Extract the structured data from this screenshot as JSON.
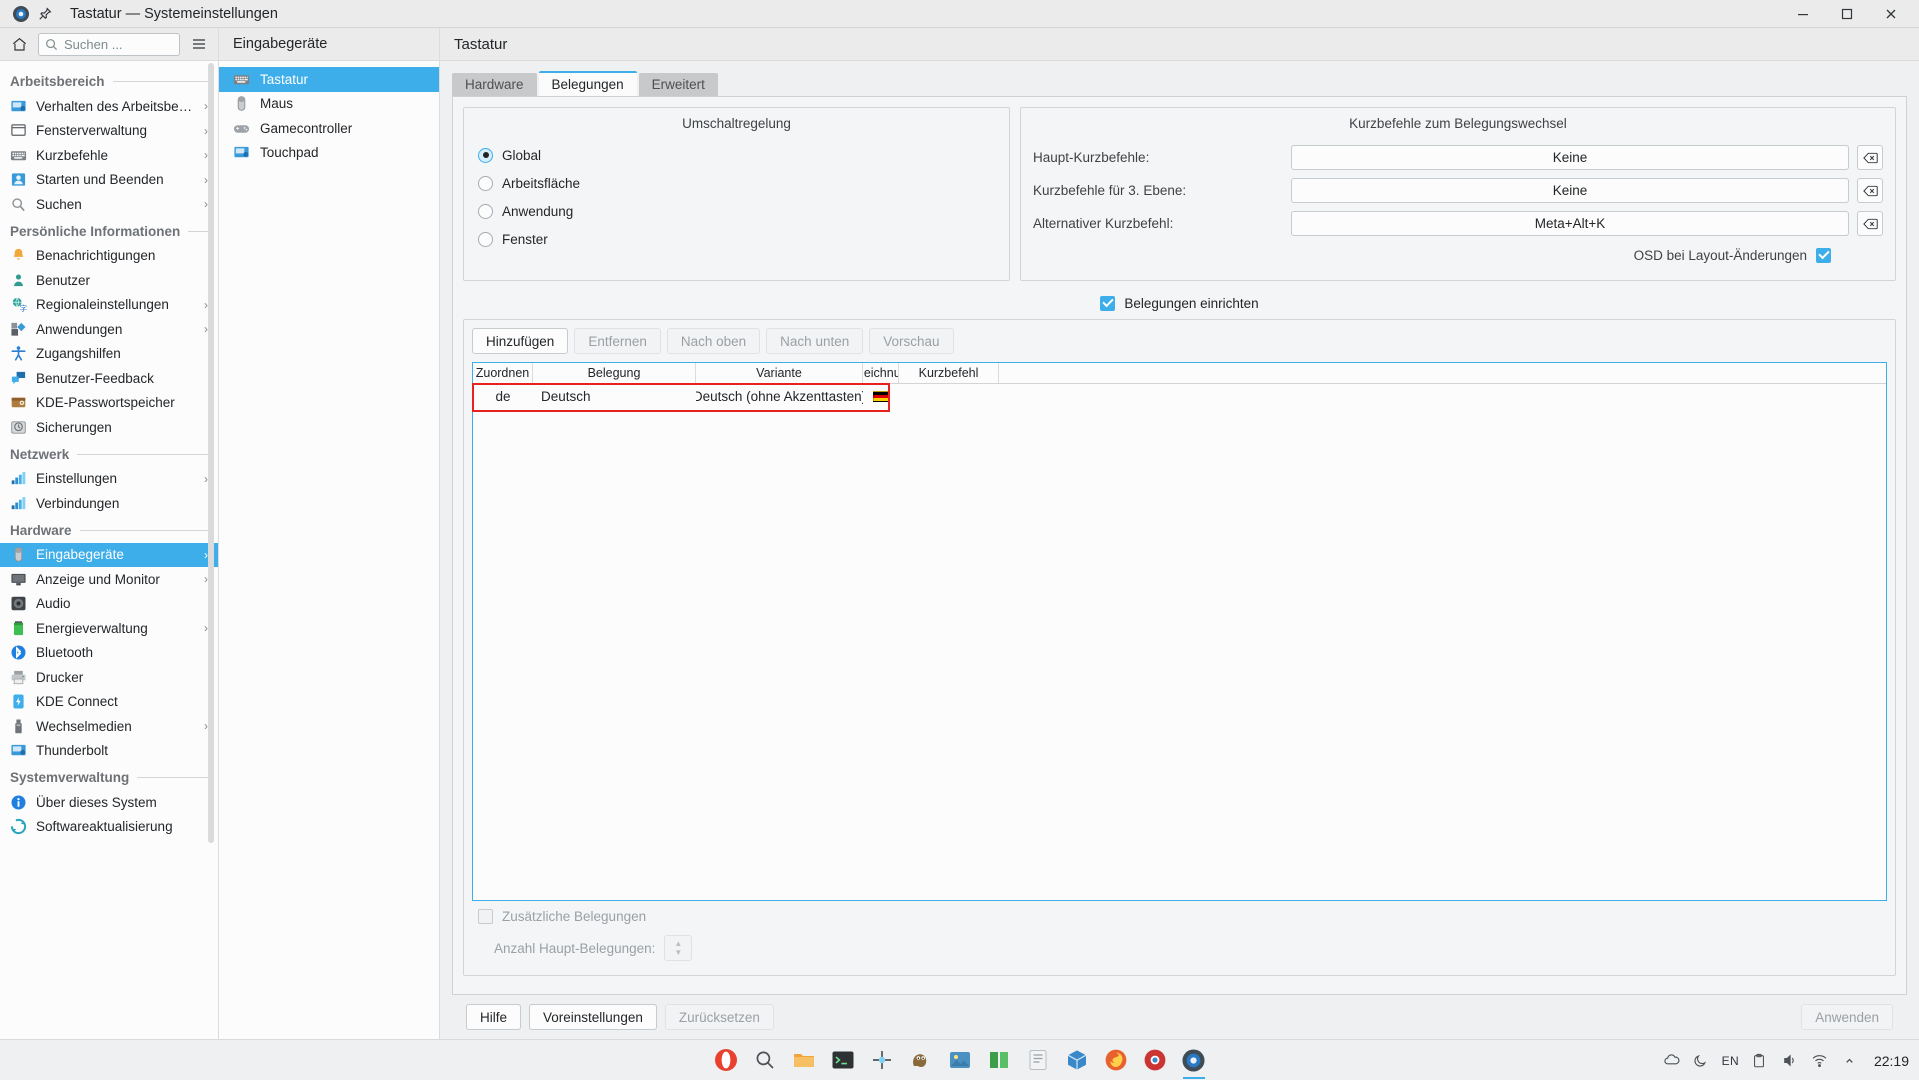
{
  "window": {
    "title": "Tastatur — Systemeinstellungen",
    "app_icon": "settings-gear-icon",
    "pin_icon": "pin-icon",
    "minimize_label": "—",
    "maximize_label": "▢",
    "close_label": "✕"
  },
  "search": {
    "placeholder": "Suchen ...",
    "icon": "search-icon",
    "home_icon": "home-icon",
    "menu_icon": "hamburger-icon"
  },
  "sidebar": {
    "sections": [
      {
        "title": "Arbeitsbereich",
        "items": [
          {
            "label": "Verhalten des Arbeitsbereic...",
            "icon": "workspace-behavior-icon",
            "chevron": true,
            "active": false
          },
          {
            "label": "Fensterverwaltung",
            "icon": "window-management-icon",
            "chevron": true,
            "active": false
          },
          {
            "label": "Kurzbefehle",
            "icon": "keyboard-shortcuts-icon",
            "chevron": true,
            "active": false
          },
          {
            "label": "Starten und Beenden",
            "icon": "startup-shutdown-icon",
            "chevron": true,
            "active": false
          },
          {
            "label": "Suchen",
            "icon": "search-magnifier-icon",
            "chevron": true,
            "active": false
          }
        ]
      },
      {
        "title": "Persönliche Informationen",
        "items": [
          {
            "label": "Benachrichtigungen",
            "icon": "bell-icon",
            "chevron": false,
            "active": false
          },
          {
            "label": "Benutzer",
            "icon": "user-icon",
            "chevron": false,
            "active": false
          },
          {
            "label": "Regionaleinstellungen",
            "icon": "globe-language-icon",
            "chevron": true,
            "active": false
          },
          {
            "label": "Anwendungen",
            "icon": "applications-icon",
            "chevron": true,
            "active": false
          },
          {
            "label": "Zugangshilfen",
            "icon": "accessibility-icon",
            "chevron": false,
            "active": false
          },
          {
            "label": "Benutzer-Feedback",
            "icon": "feedback-icon",
            "chevron": false,
            "active": false
          },
          {
            "label": "KDE-Passwortspeicher",
            "icon": "wallet-icon",
            "chevron": false,
            "active": false
          },
          {
            "label": "Sicherungen",
            "icon": "backup-icon",
            "chevron": false,
            "active": false
          }
        ]
      },
      {
        "title": "Netzwerk",
        "items": [
          {
            "label": "Einstellungen",
            "icon": "network-settings-icon",
            "chevron": true,
            "active": false
          },
          {
            "label": "Verbindungen",
            "icon": "network-connections-icon",
            "chevron": false,
            "active": false
          }
        ]
      },
      {
        "title": "Hardware",
        "items": [
          {
            "label": "Eingabegeräte",
            "icon": "input-devices-icon",
            "chevron": true,
            "active": true
          },
          {
            "label": "Anzeige und Monitor",
            "icon": "display-monitor-icon",
            "chevron": true,
            "active": false
          },
          {
            "label": "Audio",
            "icon": "audio-icon",
            "chevron": false,
            "active": false
          },
          {
            "label": "Energieverwaltung",
            "icon": "battery-icon",
            "chevron": true,
            "active": false
          },
          {
            "label": "Bluetooth",
            "icon": "bluetooth-icon",
            "chevron": false,
            "active": false
          },
          {
            "label": "Drucker",
            "icon": "printer-icon",
            "chevron": false,
            "active": false
          },
          {
            "label": "KDE Connect",
            "icon": "kde-connect-icon",
            "chevron": false,
            "active": false
          },
          {
            "label": "Wechselmedien",
            "icon": "removable-media-icon",
            "chevron": true,
            "active": false
          },
          {
            "label": "Thunderbolt",
            "icon": "thunderbolt-icon",
            "chevron": false,
            "active": false
          }
        ]
      },
      {
        "title": "Systemverwaltung",
        "items": [
          {
            "label": "Über dieses System",
            "icon": "info-icon",
            "chevron": false,
            "active": false
          },
          {
            "label": "Softwareaktualisierung",
            "icon": "software-update-icon",
            "chevron": false,
            "active": false
          }
        ]
      }
    ]
  },
  "module_list": {
    "header": "Eingabegeräte",
    "items": [
      {
        "label": "Tastatur",
        "icon": "keyboard-icon",
        "active": true
      },
      {
        "label": "Maus",
        "icon": "mouse-icon",
        "active": false
      },
      {
        "label": "Gamecontroller",
        "icon": "gamepad-icon",
        "active": false
      },
      {
        "label": "Touchpad",
        "icon": "touchpad-icon",
        "active": false
      }
    ]
  },
  "content": {
    "header": "Tastatur",
    "tabs": [
      {
        "label": "Hardware",
        "active": false
      },
      {
        "label": "Belegungen",
        "active": true
      },
      {
        "label": "Erweitert",
        "active": false
      }
    ],
    "switching_policy": {
      "title": "Umschaltregelung",
      "options": [
        {
          "label": "Global",
          "selected": true
        },
        {
          "label": "Arbeitsfläche",
          "selected": false
        },
        {
          "label": "Anwendung",
          "selected": false
        },
        {
          "label": "Fenster",
          "selected": false
        }
      ]
    },
    "shortcuts": {
      "title": "Kurzbefehle zum Belegungswechsel",
      "rows": [
        {
          "label": "Haupt-Kurzbefehle:",
          "value": "Keine",
          "clear_icon": "clear-shortcut-icon"
        },
        {
          "label": "Kurzbefehle für 3. Ebene:",
          "value": "Keine",
          "clear_icon": "clear-shortcut-icon"
        },
        {
          "label": "Alternativer Kurzbefehl:",
          "value": "Meta+Alt+K",
          "clear_icon": "clear-shortcut-icon"
        }
      ],
      "osd": {
        "label": "OSD bei Layout-Änderungen",
        "checked": true
      }
    },
    "configure_layouts": {
      "label": "Belegungen einrichten",
      "checked": true
    },
    "layout_buttons": [
      {
        "label": "Hinzufügen",
        "disabled": false
      },
      {
        "label": "Entfernen",
        "disabled": true
      },
      {
        "label": "Nach oben",
        "disabled": true
      },
      {
        "label": "Nach unten",
        "disabled": true
      },
      {
        "label": "Vorschau",
        "disabled": true
      }
    ],
    "layout_table": {
      "columns": [
        "Zuordnen",
        "Belegung",
        "Variante",
        ":eichnu",
        "Kurzbefehl",
        ""
      ],
      "rows": [
        {
          "assign": "de",
          "layout": "Deutsch",
          "variant": "Deutsch (ohne Akzenttasten)",
          "flag": "flag-de-icon",
          "shortcut": "",
          "highlighted": true
        }
      ]
    },
    "extra_layouts": {
      "label": "Zusätzliche Belegungen",
      "checked": false,
      "disabled": true
    },
    "main_count": {
      "label": "Anzahl Haupt-Belegungen:",
      "value": "",
      "disabled": true
    },
    "footer_buttons": [
      {
        "label": "Hilfe",
        "disabled": false
      },
      {
        "label": "Voreinstellungen",
        "disabled": false
      },
      {
        "label": "Zurücksetzen",
        "disabled": true
      },
      {
        "label": "Anwenden",
        "disabled": true
      }
    ]
  },
  "taskbar": {
    "launchers": [
      {
        "icon": "opera-icon",
        "color": "#e8412f"
      },
      {
        "icon": "search-icon",
        "color": "#4d5256"
      },
      {
        "icon": "file-manager-icon",
        "color": "#f0a43a"
      },
      {
        "icon": "terminal-icon",
        "color": "#2d3134"
      },
      {
        "icon": "dev-tool-icon",
        "color": "#4d5256"
      },
      {
        "icon": "gimp-icon",
        "color": "#8a6a3a"
      },
      {
        "icon": "image-viewer-icon",
        "color": "#4a90c2"
      },
      {
        "icon": "book-icon",
        "color": "#3d9e4a"
      },
      {
        "icon": "text-editor-icon",
        "color": "#dcdee0"
      },
      {
        "icon": "packages-icon",
        "color": "#3a88c8"
      },
      {
        "icon": "firefox-icon",
        "color": "#e8622f"
      },
      {
        "icon": "browser-icon",
        "color": "#cc3333"
      },
      {
        "icon": "settings-gear-icon",
        "color": "#3daee9",
        "active": true
      }
    ],
    "tray": [
      {
        "icon": "cloud-sync-icon"
      },
      {
        "icon": "night-color-icon"
      },
      {
        "icon": "keyboard-layout-badge",
        "label": "EN"
      },
      {
        "icon": "clipboard-icon"
      },
      {
        "icon": "volume-icon"
      },
      {
        "icon": "network-icon"
      },
      {
        "icon": "expand-tray-icon"
      }
    ],
    "clock": "22:19"
  }
}
